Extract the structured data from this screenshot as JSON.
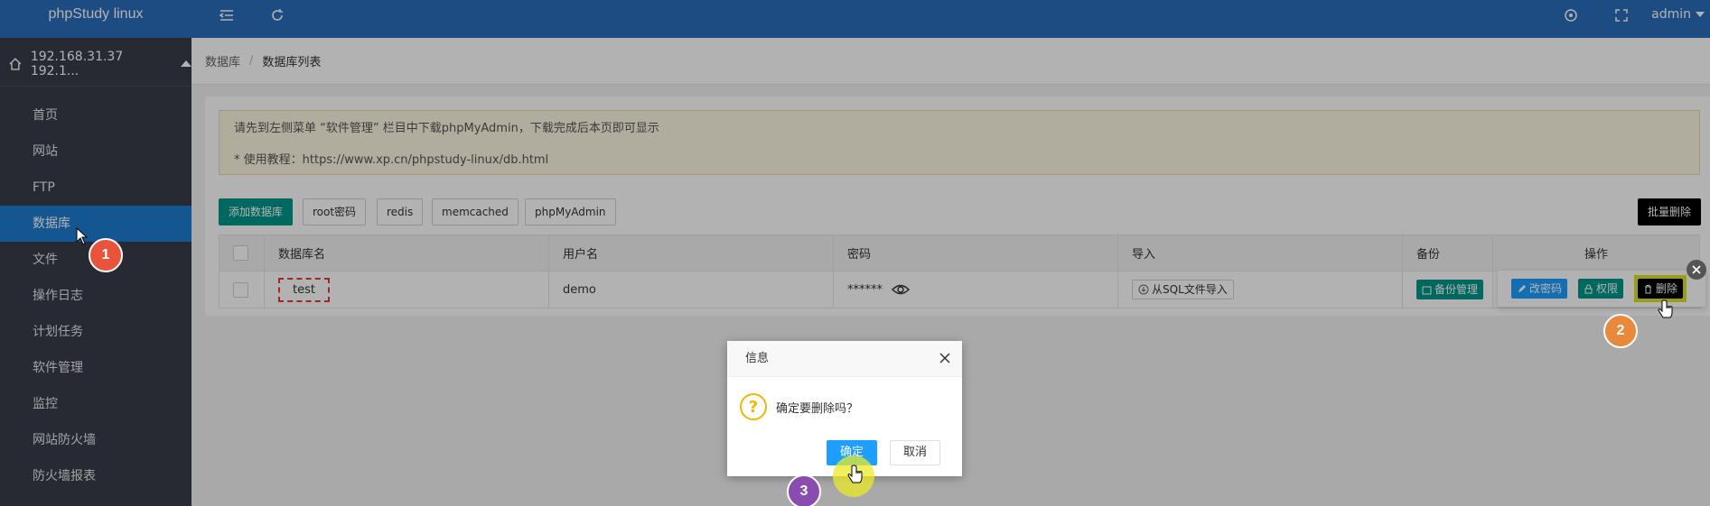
{
  "app": {
    "brand": "phpStudy linux"
  },
  "topbar": {
    "user": "admin"
  },
  "sidebar": {
    "host": "192.168.31.37 192.1...",
    "items": [
      {
        "label": "首页"
      },
      {
        "label": "网站"
      },
      {
        "label": "FTP"
      },
      {
        "label": "数据库"
      },
      {
        "label": "文件"
      },
      {
        "label": "操作日志"
      },
      {
        "label": "计划任务"
      },
      {
        "label": "软件管理"
      },
      {
        "label": "监控"
      },
      {
        "label": "网站防火墙"
      },
      {
        "label": "防火墙报表"
      }
    ]
  },
  "breadcrumb": {
    "parent": "数据库",
    "sep": "/",
    "current": "数据库列表"
  },
  "notice": {
    "line1": "请先到左侧菜单 “软件管理” 栏目中下载phpMyAdmin，下载完成后本页即可显示",
    "line2": "* 使用教程：https://www.xp.cn/phpstudy-linux/db.html"
  },
  "toolbar": {
    "add_db": "添加数据库",
    "root_pwd": "root密码",
    "redis": "redis",
    "memcached": "memcached",
    "phpmyadmin": "phpMyAdmin",
    "batch_delete": "批量删除"
  },
  "table": {
    "headers": [
      "数据库名",
      "用户名",
      "密码",
      "导入",
      "备份",
      "操作"
    ],
    "row": {
      "db_name": "test",
      "user": "demo",
      "password": "******",
      "import": "从SQL文件导入",
      "backup": "备份管理",
      "change_pwd": "改密码",
      "perm": "权限",
      "delete": "删除"
    }
  },
  "dialog": {
    "title": "信息",
    "message": "确定要删除吗？",
    "confirm": "确定",
    "cancel": "取消"
  },
  "annotations": {
    "step1": "1",
    "step2": "2",
    "step3": "3"
  },
  "colors": {
    "brand_blue": "#2a6ebb",
    "sidebar": "#393d49",
    "active": "#1e7bd1",
    "teal": "#009688",
    "step1": "#e8533c",
    "step2": "#e8893c",
    "step3": "#8a4cb0"
  }
}
